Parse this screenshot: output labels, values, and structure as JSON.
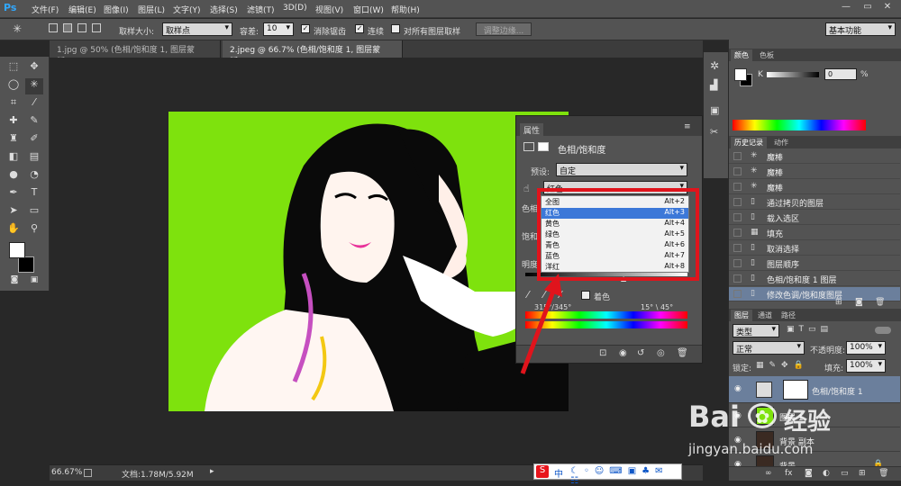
{
  "app": {
    "logo": "Ps"
  },
  "menu": [
    "文件(F)",
    "编辑(E)",
    "图像(I)",
    "图层(L)",
    "文字(Y)",
    "选择(S)",
    "滤镜(T)",
    "3D(D)",
    "视图(V)",
    "窗口(W)",
    "帮助(H)"
  ],
  "window_controls": [
    "—",
    "▭",
    "✕"
  ],
  "options_bar": {
    "sample_size_label": "取样大小:",
    "sample_size_value": "取样点",
    "tolerance_label": "容差:",
    "tolerance_value": "10",
    "antialias_label": "消除锯齿",
    "contiguous_label": "连续",
    "all_layers_label": "对所有图层取样",
    "refine_edge_label": "调整边缘...",
    "workspace_value": "基本功能"
  },
  "tabs": [
    {
      "label": "1.jpg @ 50% (色相/饱和度 1, 图层蒙版/8) *",
      "close": "×"
    },
    {
      "label": "2.jpeg @ 66.7% (色相/饱和度 1, 图层蒙版/8) *",
      "close": "×"
    }
  ],
  "status": {
    "zoom": "66.67%",
    "doc": "文档:1.78M/5.92M"
  },
  "properties": {
    "title": "属性",
    "adjustment_name": "色相/饱和度",
    "preset_label": "预设:",
    "preset_value": "自定",
    "channel_value": "红色",
    "hue_label": "色相:",
    "saturation_label": "饱和度:",
    "lightness_label": "明度:",
    "colorize_label": "着色",
    "range_left": "315°/345°",
    "range_right": "15° \\ 45°",
    "dropdown_options": [
      {
        "label": "全图",
        "shortcut": "Alt+2",
        "selected": false
      },
      {
        "label": "红色",
        "shortcut": "Alt+3",
        "selected": true
      },
      {
        "label": "黄色",
        "shortcut": "Alt+4",
        "selected": false
      },
      {
        "label": "绿色",
        "shortcut": "Alt+5",
        "selected": false
      },
      {
        "label": "青色",
        "shortcut": "Alt+6",
        "selected": false
      },
      {
        "label": "蓝色",
        "shortcut": "Alt+7",
        "selected": false
      },
      {
        "label": "洋红",
        "shortcut": "Alt+8",
        "selected": false
      }
    ]
  },
  "color_panel": {
    "tabs": [
      "颜色",
      "色板"
    ],
    "k_label": "K",
    "k_value": "0",
    "percent": "%"
  },
  "history_panel": {
    "tabs": [
      "历史记录",
      "动作"
    ],
    "items": [
      {
        "label": "魔棒",
        "icon": "magic-wand-icon",
        "selected": false
      },
      {
        "label": "魔棒",
        "icon": "magic-wand-icon",
        "selected": false
      },
      {
        "label": "魔棒",
        "icon": "magic-wand-icon",
        "selected": false
      },
      {
        "label": "通过拷贝的图层",
        "icon": "document-icon",
        "selected": false
      },
      {
        "label": "载入选区",
        "icon": "document-icon",
        "selected": false
      },
      {
        "label": "填充",
        "icon": "grid-icon",
        "selected": false
      },
      {
        "label": "取消选择",
        "icon": "document-icon",
        "selected": false
      },
      {
        "label": "图层顺序",
        "icon": "document-icon",
        "selected": false
      },
      {
        "label": "色相/饱和度 1 图层",
        "icon": "document-icon",
        "selected": false
      },
      {
        "label": "修改色调/饱和度图层",
        "icon": "document-icon",
        "selected": true
      }
    ]
  },
  "layers_panel": {
    "tabs": [
      "图层",
      "通道",
      "路径"
    ],
    "kind_value": "类型",
    "blend_value": "正常",
    "opacity_label": "不透明度:",
    "opacity_value": "100%",
    "lock_label": "锁定:",
    "fill_label": "填充:",
    "fill_value": "100%",
    "layers": [
      {
        "name": "色相/饱和度 1",
        "selected": true
      },
      {
        "name": "图层 1",
        "selected": false
      },
      {
        "name": "背景 副本",
        "selected": false
      },
      {
        "name": "背景",
        "selected": false
      }
    ],
    "footer_icons": [
      "link-icon",
      "fx-icon",
      "mask-icon",
      "adjustment-icon",
      "folder-icon",
      "new-layer-icon",
      "trash-icon"
    ]
  },
  "watermark": {
    "brand": "Bai",
    "brand2": "经验",
    "url": "jingyan.baidu.com"
  },
  "ime_bar": {
    "label": "中"
  },
  "colors": {
    "canvas_bg": "#7ee20d",
    "highlight_box": "#e0141c",
    "selection": "#3c78d8"
  }
}
